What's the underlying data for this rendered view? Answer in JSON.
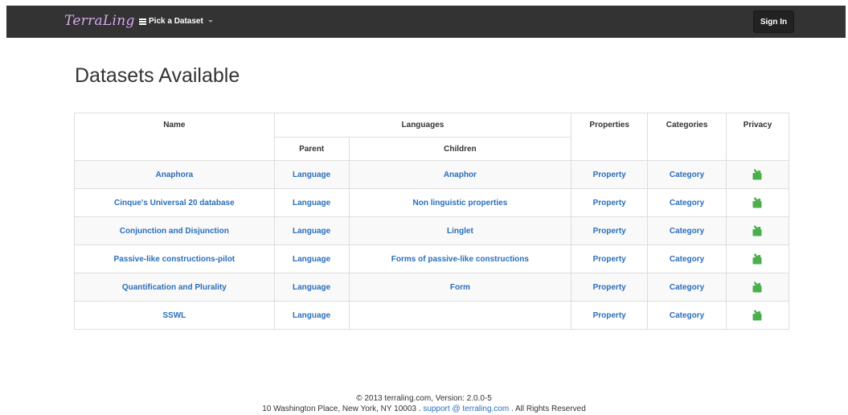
{
  "navbar": {
    "brand": "TerraLing",
    "picker_label": "Pick a Dataset",
    "signin_label": "Sign In"
  },
  "page_title": "Datasets Available",
  "table": {
    "headers": {
      "name": "Name",
      "languages": "Languages",
      "parent": "Parent",
      "children": "Children",
      "properties": "Properties",
      "categories": "Categories",
      "privacy": "Privacy"
    },
    "rows": [
      {
        "name": "Anaphora",
        "parent": "Language",
        "children": "Anaphor",
        "properties": "Property",
        "categories": "Category",
        "privacy": "unlocked"
      },
      {
        "name": "Cinque's Universal 20 database",
        "parent": "Language",
        "children": "Non linguistic properties",
        "properties": "Property",
        "categories": "Category",
        "privacy": "unlocked"
      },
      {
        "name": "Conjunction and Disjunction",
        "parent": "Language",
        "children": "Linglet",
        "properties": "Property",
        "categories": "Category",
        "privacy": "unlocked"
      },
      {
        "name": "Passive-like constructions-pilot",
        "parent": "Language",
        "children": "Forms of passive-like constructions",
        "properties": "Property",
        "categories": "Category",
        "privacy": "unlocked"
      },
      {
        "name": "Quantification and Plurality",
        "parent": "Language",
        "children": "Form",
        "properties": "Property",
        "categories": "Category",
        "privacy": "unlocked"
      },
      {
        "name": "SSWL",
        "parent": "Language",
        "children": "",
        "properties": "Property",
        "categories": "Category",
        "privacy": "unlocked"
      }
    ]
  },
  "footer": {
    "line1": "© 2013 terraling.com, Version: 2.0.0-5",
    "address": "10 Washington Place, New York, NY 10003 .",
    "support_link": "support @ terraling.com",
    "rights": ". All Rights Reserved"
  },
  "colors": {
    "navbar": "#333333",
    "brand": "#d6a8ef",
    "link": "#2a6ebb",
    "lock": "#4cae4c"
  },
  "icons": {
    "privacy": "unlock-icon",
    "menu": "bars-icon"
  }
}
